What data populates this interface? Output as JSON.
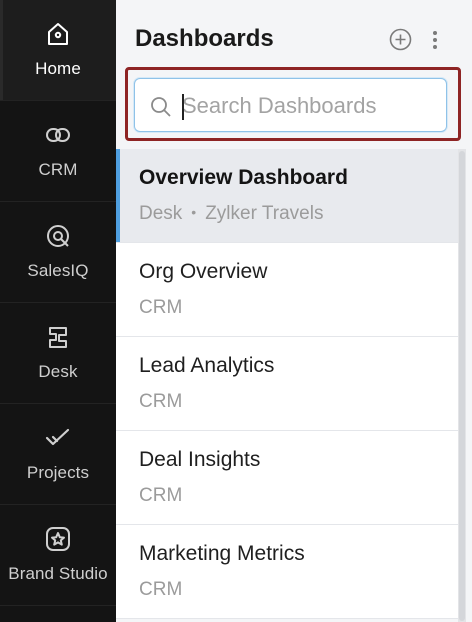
{
  "nav": {
    "items": [
      {
        "label": "Home",
        "icon": "home-icon"
      },
      {
        "label": "CRM",
        "icon": "crm-icon"
      },
      {
        "label": "SalesIQ",
        "icon": "salesiq-icon"
      },
      {
        "label": "Desk",
        "icon": "desk-icon"
      },
      {
        "label": "Projects",
        "icon": "projects-icon"
      },
      {
        "label": "Brand Studio",
        "icon": "brand-studio-icon"
      }
    ],
    "active": "Home"
  },
  "panel": {
    "title": "Dashboards",
    "add_icon": "add-circle-icon",
    "more_icon": "more-vertical-icon"
  },
  "search": {
    "placeholder": "Search Dashboards",
    "value": ""
  },
  "dashboards": [
    {
      "title": "Overview Dashboard",
      "app": "Desk",
      "separator": "•",
      "org": "Zylker Travels",
      "selected": true
    },
    {
      "title": "Org Overview",
      "app": "CRM"
    },
    {
      "title": "Lead Analytics",
      "app": "CRM"
    },
    {
      "title": "Deal Insights",
      "app": "CRM"
    },
    {
      "title": "Marketing Metrics",
      "app": "CRM"
    }
  ],
  "colors": {
    "nav_bg": "#141414",
    "panel_bg": "#f4f5f7",
    "accent": "#4f9fe0",
    "focus_outline": "#8e2424",
    "search_border": "#8fc2e8"
  }
}
